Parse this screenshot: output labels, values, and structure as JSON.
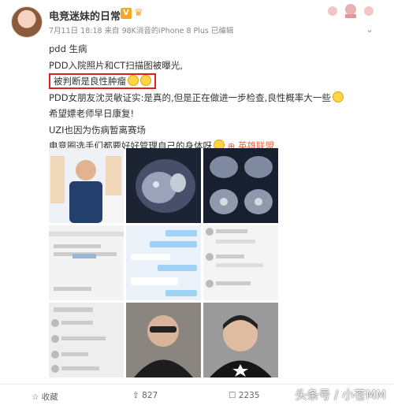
{
  "post": {
    "username": "电竞迷妹的日常",
    "badge": "V",
    "meta": "7月11日 18:18 来自 98K消音的iPhone 8 Plus  已编辑",
    "menu_icon": "chevron-down-icon",
    "lines": [
      "pdd 生病",
      "PDD入院照片和CT扫描图被曝光,",
      "被判断是良性肿瘤",
      "PDD女朋友沈灵敏证实:是真的,但是正在做进一步检查,良性概率大一些",
      "希望嫖老师早日康复!",
      "UZI也因为伤病暂离赛场",
      "电竞圈选手们都要好好管理自己的身体呀"
    ],
    "link_text": "英雄联盟",
    "highlight_color": "#e02020",
    "accent_color": "#e8643f"
  },
  "images": [
    {
      "name": "hospital-photo",
      "label": ""
    },
    {
      "name": "ct-scan-1",
      "label": ""
    },
    {
      "name": "ct-scan-2",
      "label": ""
    },
    {
      "name": "chat-screenshot-1",
      "label": "你好 在下 发表的",
      "sub": "吧,希望没有严重吧"
    },
    {
      "name": "chat-screenshot-2",
      "label": ""
    },
    {
      "name": "chat-screenshot-3",
      "label": ""
    },
    {
      "name": "chat-screenshot-4",
      "label": ""
    },
    {
      "name": "portrait-photo-1",
      "label": ""
    },
    {
      "name": "portrait-photo-2",
      "label": ""
    }
  ],
  "footer": {
    "favorite_label": "收藏",
    "share_count": "827",
    "comment_count": "2235"
  },
  "watermark": "头条号 / 小苍MM"
}
